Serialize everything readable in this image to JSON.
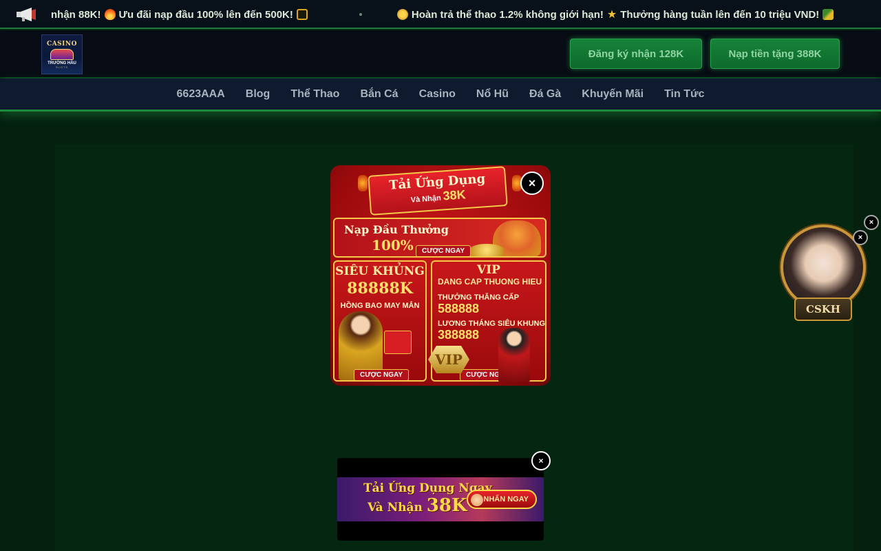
{
  "ticker": {
    "icon": "megaphone-icon",
    "segment1": "nhận 88K!",
    "segment2": "Ưu đãi nạp đầu 100% lên đến 500K!",
    "segment3": "Hoàn trả thể thao 1.2% không giới hạn!",
    "segment4": "Thưởng hàng tuần lên đến 10 triệu VND!"
  },
  "header": {
    "logo": {
      "top": "CASINO",
      "bottom": "TRƯỜNG HẦU",
      "sub": "SLOTS"
    },
    "register_button": "Đăng ký nhận 128K",
    "deposit_button": "Nạp tiền tặng 388K"
  },
  "nav": {
    "items": [
      "6623AAA",
      "Blog",
      "Thể Thao",
      "Bắn Cá",
      "Casino",
      "Nổ Hũ",
      "Đá Gà",
      "Khuyến Mãi",
      "Tin Tức"
    ]
  },
  "popup": {
    "close_symbol": "×",
    "ribbon_title": "Tải Ứng Dụng",
    "ribbon_sub_prefix": "Và Nhận",
    "ribbon_sub_amount": "38K",
    "first_deposit_title": "Nạp Đầu Thưởng",
    "first_deposit_value": "100%",
    "bet_now": "CƯỢC NGAY",
    "left_title": "SIÊU KHỦNG",
    "left_amount": "88888K",
    "left_sub": "HỒNG BAO MAY MẮN",
    "vip_title": "VIP",
    "vip_sub": "DANG CAP THUONG HIEU",
    "vip_upgrade_label": "THƯỞNG THĂNG CẤP",
    "vip_upgrade_value": "588888",
    "vip_salary_label": "LƯƠNG THÁNG SIÊU KHUNG",
    "vip_salary_value": "388888",
    "vip_badge": "VIP"
  },
  "side_widget": {
    "label": "CSKH",
    "close_symbol": "×"
  },
  "bottom_banner": {
    "line1": "Tải Ứng Dụng Ngay",
    "line2_prefix": "Và Nhận",
    "line2_amount": "38K",
    "button": "NHẤN NGAY",
    "close_symbol": "×"
  }
}
